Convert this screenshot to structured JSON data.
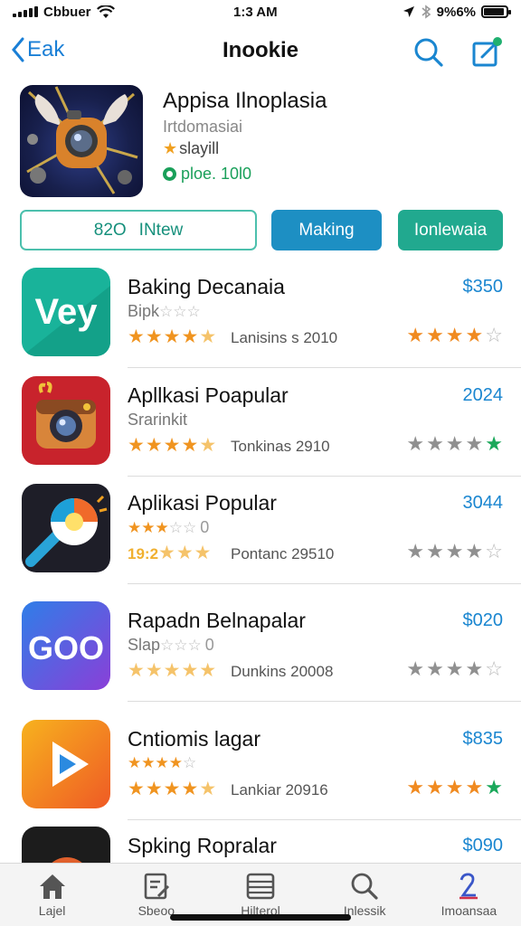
{
  "status": {
    "carrier": "Cbbuer",
    "time": "1:3 AM",
    "battery": "9%6%"
  },
  "nav": {
    "back_label": "Eak",
    "title": "Inookie"
  },
  "featured": {
    "name": "Appisa Ilnoplasia",
    "developer": "Irtdomasiai",
    "rating": "slayill",
    "price": "ploe. 10l0"
  },
  "actions": {
    "outline_left": "82O",
    "outline_right": "INtew",
    "blue": "Making",
    "green": "Ionlewaia"
  },
  "apps": [
    {
      "name": "Baking Decanaia",
      "subtitle": "Bipk",
      "sub_stars": 0,
      "sub_empty": 3,
      "sub_extra": "",
      "price": "$350",
      "meta": "Lanisins s 2010",
      "left_stars": "★★★★",
      "left_dim": "★",
      "right_stars": [
        {
          "c": "o",
          "v": "★"
        },
        {
          "c": "o",
          "v": "★"
        },
        {
          "c": "o",
          "v": "★"
        },
        {
          "c": "o",
          "v": "★"
        },
        {
          "c": "e",
          "v": "☆"
        }
      ]
    },
    {
      "name": "Apllkasi Poapular",
      "subtitle": "Srarinkit",
      "sub_stars": 0,
      "sub_empty": 0,
      "sub_extra": "",
      "price": "2024",
      "meta": "Tonkinas 2910",
      "left_stars": "★★★★",
      "left_dim": "★",
      "right_stars": [
        {
          "c": "g",
          "v": "★"
        },
        {
          "c": "g",
          "v": "★"
        },
        {
          "c": "g",
          "v": "★"
        },
        {
          "c": "g",
          "v": "★"
        },
        {
          "c": "gr",
          "v": "★"
        }
      ]
    },
    {
      "name": "Aplikasi Popular",
      "subtitle": "",
      "sub_stars": 3,
      "sub_empty": 2,
      "sub_extra": "0",
      "price": "3044",
      "meta": "Pontanc 29510",
      "left_stars": "",
      "left_mixed": "19:2",
      "left_dim": "★★★",
      "right_stars": [
        {
          "c": "g",
          "v": "★"
        },
        {
          "c": "g",
          "v": "★"
        },
        {
          "c": "g",
          "v": "★"
        },
        {
          "c": "g",
          "v": "★"
        },
        {
          "c": "e",
          "v": "☆"
        }
      ]
    },
    {
      "name": "Rapadn Belnapalar",
      "subtitle": "Slap",
      "sub_stars": 0,
      "sub_empty": 3,
      "sub_extra": "0",
      "price": "$020",
      "meta": "Dunkins 20008",
      "left_stars": "",
      "left_dim": "★★★★★",
      "right_stars": [
        {
          "c": "g",
          "v": "★"
        },
        {
          "c": "g",
          "v": "★"
        },
        {
          "c": "g",
          "v": "★"
        },
        {
          "c": "g",
          "v": "★"
        },
        {
          "c": "e",
          "v": "☆"
        }
      ]
    },
    {
      "name": "Cntiomis lagar",
      "subtitle": "",
      "sub_stars": 4,
      "sub_empty": 1,
      "sub_extra": "",
      "price": "$835",
      "meta": "Lankiar 20916",
      "left_stars": "★★★★",
      "left_dim": "★",
      "right_stars": [
        {
          "c": "o",
          "v": "★"
        },
        {
          "c": "o",
          "v": "★"
        },
        {
          "c": "o",
          "v": "★"
        },
        {
          "c": "o",
          "v": "★"
        },
        {
          "c": "gr",
          "v": "★"
        }
      ]
    },
    {
      "name": "Spking Ropralar",
      "subtitle": "",
      "sub_stars": 0,
      "sub_empty": 0,
      "sub_extra": "",
      "price": "$090",
      "meta": "",
      "left_stars": "",
      "left_dim": "",
      "right_stars": []
    }
  ],
  "app_icons": [
    {
      "kind": "vey",
      "text": "Vey",
      "bg": "#19b39a"
    },
    {
      "kind": "camera",
      "bg": "#c8232c"
    },
    {
      "kind": "pin",
      "bg": "#1e1e28"
    },
    {
      "kind": "goo",
      "text": "GOO",
      "bg": "#3f6fe0"
    },
    {
      "kind": "play",
      "bg": "#f39a1a"
    },
    {
      "kind": "dark",
      "bg": "#1c1c1c"
    }
  ],
  "tabs": [
    {
      "id": "home",
      "label": "Lajel"
    },
    {
      "id": "doc",
      "label": "Sbeoo"
    },
    {
      "id": "list",
      "label": "Hilterol"
    },
    {
      "id": "search",
      "label": "Inlessik"
    },
    {
      "id": "profile",
      "label": "Imoansaa"
    }
  ],
  "colors": {
    "accent": "#1a86d0",
    "teal": "#21a98f",
    "star": "#f09420",
    "green": "#1aa85a"
  }
}
